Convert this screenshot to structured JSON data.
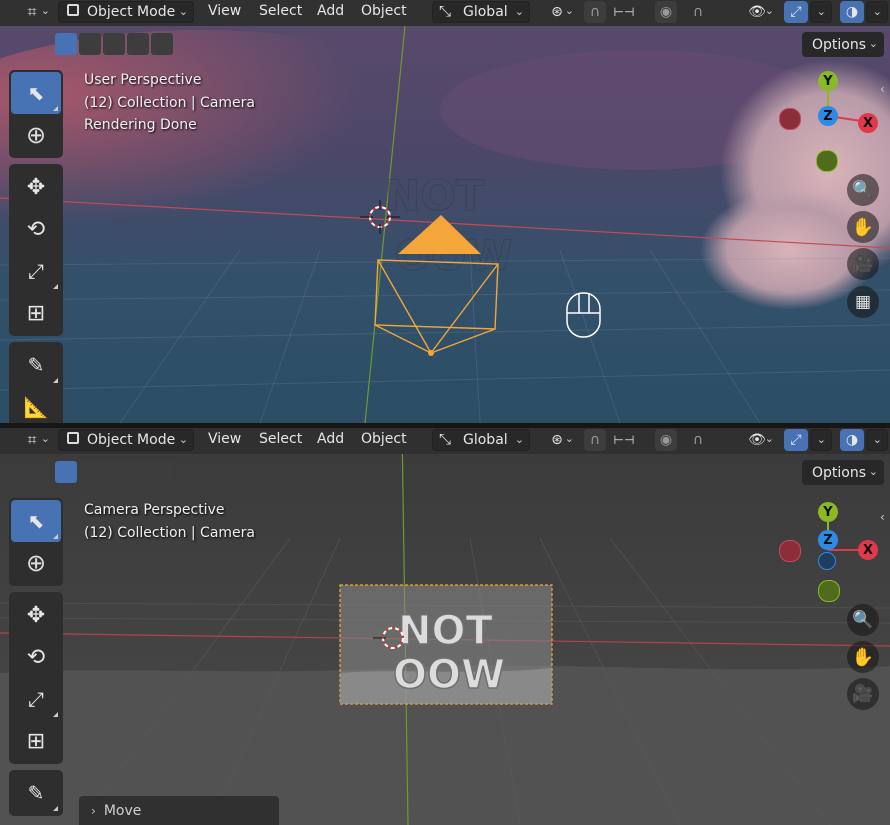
{
  "header": {
    "object_mode_label": "Object Mode",
    "menus": [
      "View",
      "Select",
      "Add",
      "Object"
    ],
    "transform_orientation": "Global",
    "options_label": "Options"
  },
  "top_viewport": {
    "perspective": "User Perspective",
    "collection": "(12) Collection | Camera",
    "status": "Rendering Done"
  },
  "bottom_viewport": {
    "perspective": "Camera Perspective",
    "collection": "(12) Collection | Camera",
    "camera_text_line1": "NOT",
    "camera_text_line2": "OOW"
  },
  "gizmo": {
    "x": "X",
    "y": "Y",
    "z": "Z"
  },
  "redo_panel": {
    "label": "Move"
  },
  "colors": {
    "accent": "#4772b3",
    "x_axis": "#e2394a",
    "y_axis": "#8ab925",
    "z_axis": "#2f8ae4",
    "camera_outline": "#f5a63a"
  }
}
